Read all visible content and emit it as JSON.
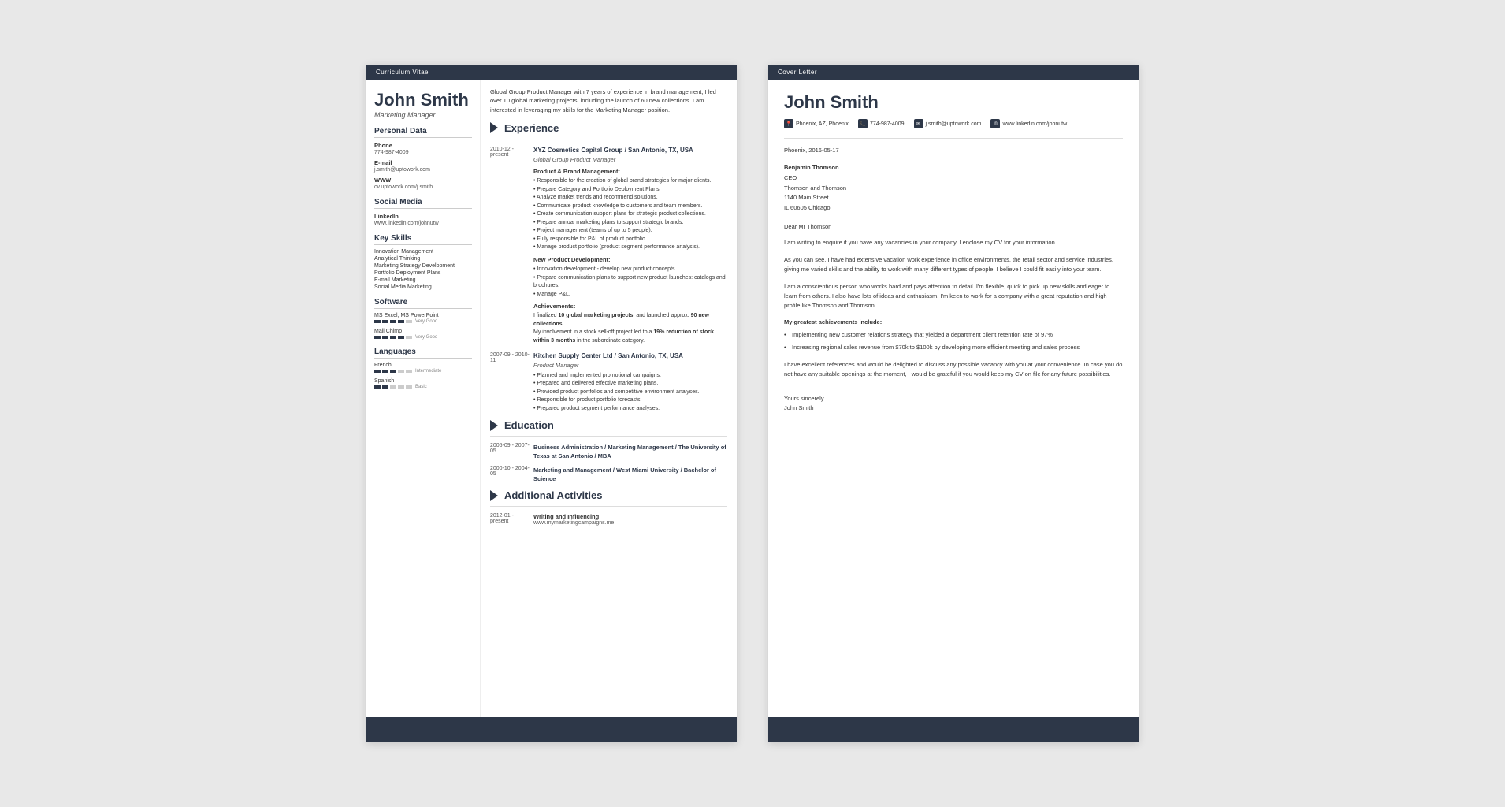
{
  "cv": {
    "header_label": "Curriculum Vitae",
    "name": "John Smith",
    "title": "Marketing Manager",
    "summary": "Global Group Product Manager with 7 years of experience in brand management, I led over 10 global marketing projects, including the launch of 60 new collections. I am interested in leveraging my skills for the Marketing Manager position.",
    "personal": {
      "section_title": "Personal Data",
      "phone_label": "Phone",
      "phone_value": "774-987-4009",
      "email_label": "E-mail",
      "email_value": "j.smith@uptowork.com",
      "www_label": "WWW",
      "www_value": "cv.uptowork.com/j.smith"
    },
    "social": {
      "section_title": "Social Media",
      "linkedin_label": "LinkedIn",
      "linkedin_value": "www.linkedin.com/johnutw"
    },
    "skills": {
      "section_title": "Key Skills",
      "items": [
        "Innovation Management",
        "Analytical Thinking",
        "Marketing Strategy Development",
        "Portfolio Deployment Plans",
        "E-mail Marketing",
        "Social Media Marketing"
      ]
    },
    "software": {
      "section_title": "Software",
      "items": [
        {
          "name": "MS Excel, MS PowerPoint",
          "rating": 4,
          "max": 5,
          "label": "Very Good"
        },
        {
          "name": "Mail Chimp",
          "rating": 4,
          "max": 5,
          "label": "Very Good"
        }
      ]
    },
    "languages": {
      "section_title": "Languages",
      "items": [
        {
          "name": "French",
          "rating": 3,
          "max": 5,
          "label": "Intermediate"
        },
        {
          "name": "Spanish",
          "rating": 2,
          "max": 5,
          "label": "Basic"
        }
      ]
    },
    "experience": {
      "section_title": "Experience",
      "entries": [
        {
          "date": "2010-12 - present",
          "company": "XYZ Cosmetics Capital Group / San Antonio, TX, USA",
          "role": "Global Group Product Manager",
          "sections": [
            {
              "title": "Product & Brand Management:",
              "bullets": [
                "Responsible for the creation of global brand strategies for major clients.",
                "Prepare Category and Portfolio Deployment Plans.",
                "Analyze market trends and recommend solutions.",
                "Communicate product knowledge to customers and team members.",
                "Create communication support plans for strategic product collections.",
                "Prepare annual marketing plans to support strategic brands.",
                "Project management (teams of up to 5 people).",
                "Fully responsible for P&L of product portfolio.",
                "Manage product portfolio (product segment performance analysis)."
              ]
            },
            {
              "title": "New Product Development:",
              "bullets": [
                "Innovation development - develop new product concepts.",
                "Prepare communication plans to support new product launches: catalogs and brochures.",
                "Manage P&L."
              ]
            },
            {
              "title": "Achievements:",
              "achievement_text": "I finalized 10 global marketing projects, and launched approx. 90 new collections.\nMy involvement in a stock sell-off project led to a 19% reduction of stock within 3 months in the subordinate category."
            }
          ]
        },
        {
          "date": "2007-09 - 2010-11",
          "company": "Kitchen Supply Center Ltd / San Antonio, TX, USA",
          "role": "Product Manager",
          "bullets": [
            "Planned and implemented promotional campaigns.",
            "Prepared and delivered effective marketing plans.",
            "Provided product portfolios and competitive environment analyses.",
            "Responsible for product portfolio forecasts.",
            "Prepared product segment performance analyses."
          ]
        }
      ]
    },
    "education": {
      "section_title": "Education",
      "entries": [
        {
          "date": "2005-09 - 2007-05",
          "degree": "Business Administration / Marketing Management / The University of Texas at San Antonio / MBA"
        },
        {
          "date": "2000-10 - 2004-05",
          "degree": "Marketing and Management / West Miami University / Bachelor of Science"
        }
      ]
    },
    "activities": {
      "section_title": "Additional Activities",
      "entries": [
        {
          "date": "2012-01 - present",
          "title": "Writing and Influencing",
          "url": "www.mymarketingcampaigns.me"
        }
      ]
    }
  },
  "cl": {
    "header_label": "Cover Letter",
    "name": "John Smith",
    "contact": {
      "location": "Phoenix, AZ, Phoenix",
      "phone": "774-987-4009",
      "email": "j.smith@uptowork.com",
      "linkedin": "www.linkedin.com/johnutw"
    },
    "date": "Phoenix, 2016-05-17",
    "recipient": {
      "name": "Benjamin Thomson",
      "title": "CEO",
      "company": "Thomson and Thomson",
      "address": "1140 Main Street",
      "city": "IL 60605 Chicago"
    },
    "salutation": "Dear Mr Thomson",
    "paragraphs": [
      "I am writing to enquire if you have any vacancies in your company. I enclose my CV for your information.",
      "As you can see, I have had extensive vacation work experience in office environments, the retail sector and service industries, giving me varied skills and the ability to work with many different types of people. I believe I could fit easily into your team.",
      "I am a conscientious person who works hard and pays attention to detail. I'm flexible, quick to pick up new skills and eager to learn from others. I also have lots of ideas and enthusiasm. I'm keen to work for a company with a great reputation and high profile like Thomson and Thomson."
    ],
    "achievements_title": "My greatest achievements include:",
    "achievements": [
      "Implementing new customer relations strategy that yielded a department client retention rate of 97%",
      "Increasing regional sales revenue from $70k to $100k by developing more efficient meeting and sales process"
    ],
    "closing": "I have excellent references and would be delighted to discuss any possible vacancy with you at your convenience. In case you do not have any suitable openings at the moment, I would be grateful if you would keep my CV on file for any future possibilities.",
    "sign_off": "Yours sincerely",
    "signature": "John Smith"
  }
}
